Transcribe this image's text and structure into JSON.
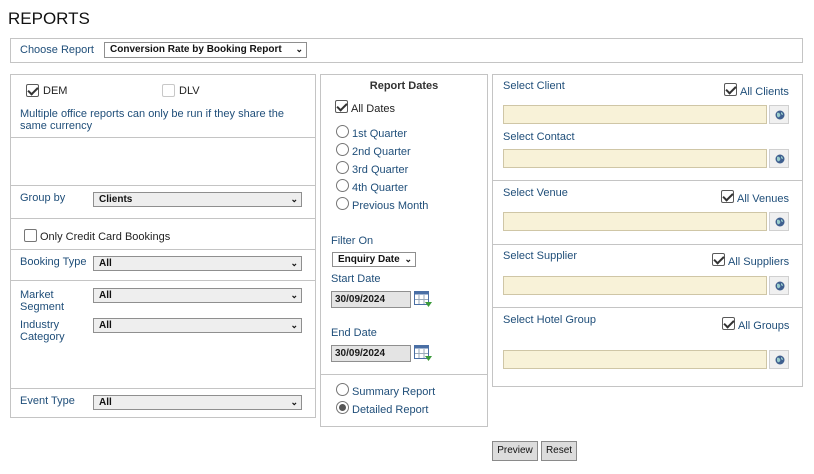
{
  "page": {
    "title": "REPORTS"
  },
  "report_chooser": {
    "label": "Choose Report",
    "selected": "Conversion Rate by Booking Report"
  },
  "offices": {
    "dem": {
      "label": "DEM",
      "checked": true
    },
    "dlv": {
      "label": "DLV",
      "checked": false
    },
    "note": "Multiple office reports can only be run if they share the same currency"
  },
  "group_by": {
    "label": "Group by",
    "selected": "Clients"
  },
  "credit_card": {
    "label": "Only Credit Card Bookings",
    "checked": false
  },
  "booking_type": {
    "label": "Booking Type",
    "selected": "All"
  },
  "market_segment": {
    "label_line1": "Market",
    "label_line2": "Segment",
    "selected": "All"
  },
  "industry_category": {
    "label_line1": "Industry",
    "label_line2": "Category",
    "selected": "All"
  },
  "event_type": {
    "label": "Event Type",
    "selected": "All"
  },
  "report_dates": {
    "title": "Report Dates",
    "all_dates": {
      "label": "All Dates",
      "checked": true
    },
    "periods": [
      "1st Quarter",
      "2nd Quarter",
      "3rd Quarter",
      "4th Quarter",
      "Previous Month"
    ]
  },
  "filter": {
    "label": "Filter On",
    "selected": "Enquiry Date",
    "start_label": "Start Date",
    "start_value": "30/09/2024",
    "end_label": "End Date",
    "end_value": "30/09/2024"
  },
  "report_style": {
    "summary": {
      "label": "Summary Report",
      "selected": false
    },
    "detailed": {
      "label": "Detailed Report",
      "selected": true
    }
  },
  "client": {
    "label": "Select Client",
    "all_label": "All Clients",
    "all_checked": true,
    "value": ""
  },
  "contact": {
    "label": "Select Contact",
    "value": ""
  },
  "venue": {
    "label": "Select Venue",
    "all_label": "All Venues",
    "all_checked": true,
    "value": ""
  },
  "supplier": {
    "label": "Select Supplier",
    "all_label": "All Suppliers",
    "all_checked": true,
    "value": ""
  },
  "hotel_group": {
    "label": "Select Hotel Group",
    "all_label": "All Groups",
    "all_checked": true,
    "value": ""
  },
  "actions": {
    "preview": "Preview",
    "reset": "Reset"
  },
  "icons": {
    "dropdown": "chevron-down-icon",
    "lookup": "globe-icon",
    "calendar": "calendar-icon"
  },
  "colors": {
    "label_blue": "#1f4e79",
    "field_yellow": "#f8f2d8",
    "border": "#c4c4c4"
  }
}
